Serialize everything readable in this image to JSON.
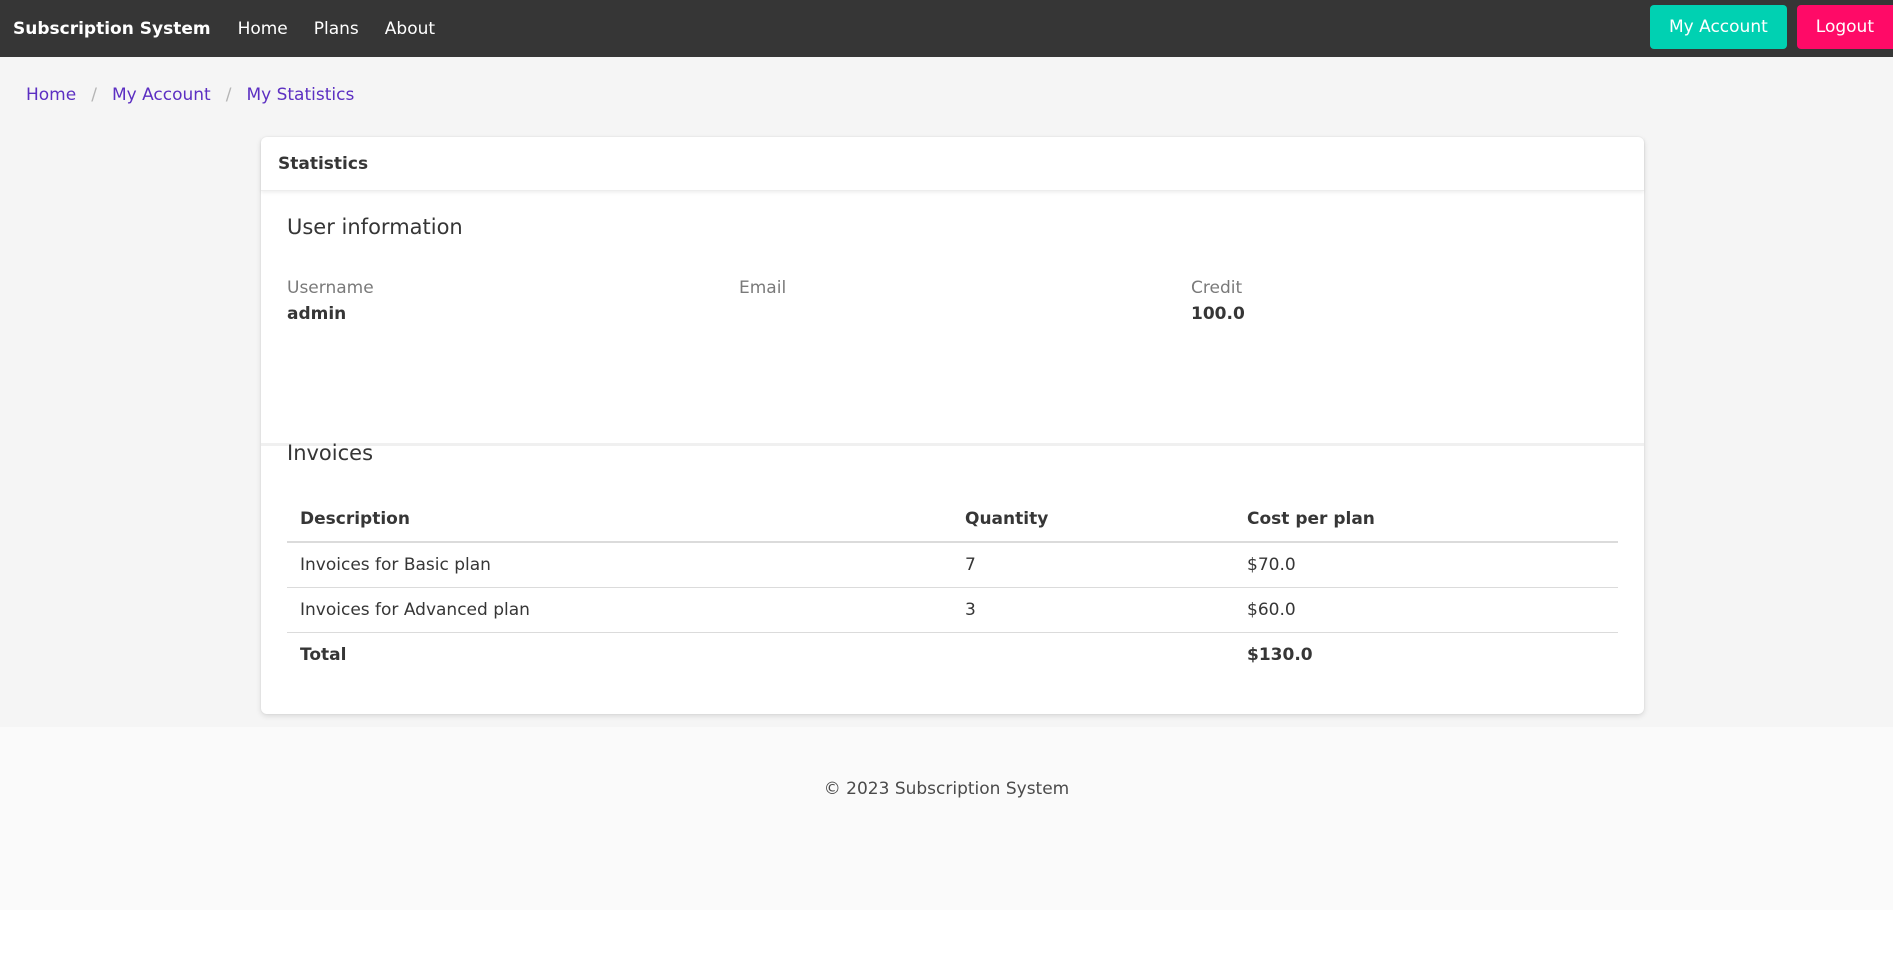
{
  "navbar": {
    "brand": "Subscription System",
    "links": [
      "Home",
      "Plans",
      "About"
    ],
    "account_button": "My Account",
    "logout_button": "Logout"
  },
  "breadcrumb": {
    "items": [
      "Home",
      "My Account",
      "My Statistics"
    ],
    "separator": "/"
  },
  "card": {
    "header": "Statistics",
    "user_info": {
      "title": "User information",
      "fields": [
        {
          "label": "Username",
          "value": "admin"
        },
        {
          "label": "Email",
          "value": ""
        },
        {
          "label": "Credit",
          "value": "100.0"
        }
      ]
    },
    "invoices": {
      "title": "Invoices",
      "columns": [
        "Description",
        "Quantity",
        "Cost per plan"
      ],
      "rows": [
        {
          "description": "Invoices for Basic plan",
          "quantity": "7",
          "cost": "$70.0"
        },
        {
          "description": "Invoices for Advanced plan",
          "quantity": "3",
          "cost": "$60.0"
        }
      ],
      "total": {
        "label": "Total",
        "quantity": "",
        "cost": "$130.0"
      }
    }
  },
  "footer": {
    "text": "© 2023 Subscription System"
  },
  "colors": {
    "navbar_bg": "#363636",
    "account_button": "#00d1b2",
    "logout_button": "#ff0a67",
    "link": "#5c2fc2"
  }
}
